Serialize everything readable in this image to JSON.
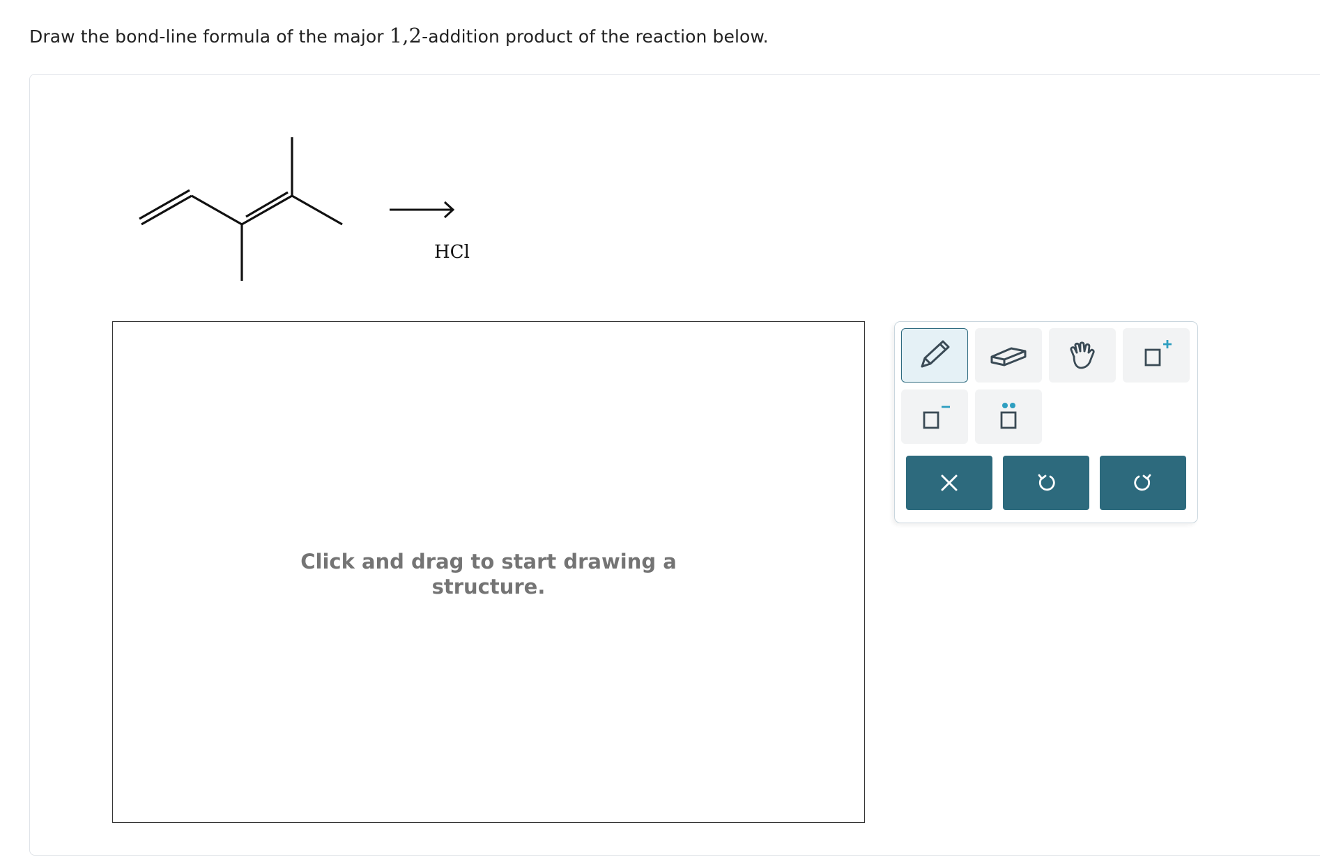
{
  "prompt": {
    "before": "Draw the bond-line formula of the major ",
    "math": "1,2",
    "after": "-addition product of the reaction below."
  },
  "reaction": {
    "reagent": "HCl"
  },
  "drawing_area": {
    "placeholder_line1": "Click and drag to start drawing a",
    "placeholder_line2": "structure."
  },
  "toolbar": {
    "tools": [
      {
        "name": "pencil-icon",
        "active": true
      },
      {
        "name": "eraser-icon",
        "active": false
      },
      {
        "name": "hand-icon",
        "active": false
      },
      {
        "name": "positive-charge-icon",
        "active": false
      },
      {
        "name": "negative-charge-icon",
        "active": false
      },
      {
        "name": "lone-pair-icon",
        "active": false
      }
    ],
    "actions": [
      "clear-icon",
      "undo-icon",
      "redo-icon"
    ],
    "colors": {
      "accent": "#2d6a7d",
      "charge_plus": "#2e9ec0"
    }
  }
}
